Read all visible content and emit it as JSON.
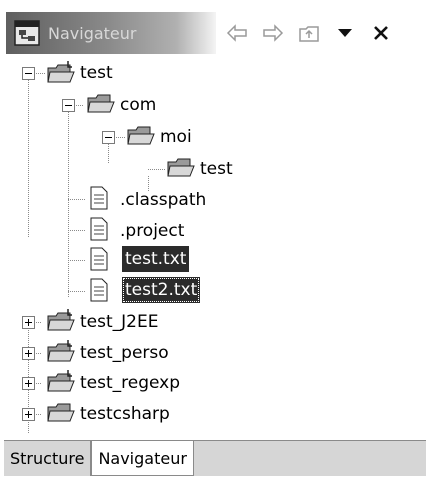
{
  "title": {
    "label": "Navigateur",
    "buttons": [
      "back-icon",
      "forward-icon",
      "up-icon",
      "menu-dropdown-icon",
      "close-icon"
    ]
  },
  "tree": {
    "test": "test",
    "com": "com",
    "moi": "moi",
    "test_inner": "test",
    "classpath": ".classpath",
    "project": ".project",
    "test_txt": "test.txt",
    "test2_txt": "test2.txt",
    "test_j2ee": "test_J2EE",
    "test_perso": "test_perso",
    "test_regexp": "test_regexp",
    "testcsharp": "testcsharp"
  },
  "bottom_tabs": {
    "structure": "Structure",
    "navigateur": "Navigateur"
  },
  "colors": {
    "selection": "#2b2b2b",
    "title_gradient_start": "#5f5f5f"
  }
}
